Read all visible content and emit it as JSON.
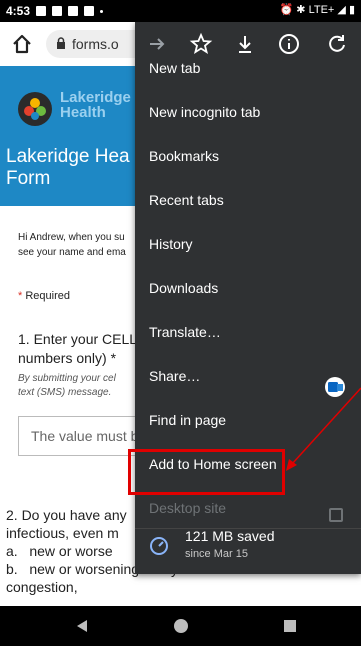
{
  "status_bar": {
    "time": "4:53",
    "network": "LTE+"
  },
  "toolbar": {
    "url": "forms.o"
  },
  "page": {
    "org_name_line1": "Lakeridge",
    "org_name_line2": "Health",
    "form_title_line1": "Lakeridge Hea",
    "form_title_line2": "Form",
    "greeting_line1": "Hi Andrew, when you su",
    "greeting_line2": "see your name and ema",
    "required_label": "Required",
    "q1_line1": "1. Enter your CELL",
    "q1_line2": "numbers only) *",
    "q1_note_line1": "By submitting your cel",
    "q1_note_line2": "text (SMS) message.",
    "answer_placeholder": "The value must b",
    "q2_line1": "2. Do you have any",
    "q2_line2": "infectious, even m",
    "q2_line3a": "a.",
    "q2_line3b": "new or worse",
    "q2_line4a": "b.",
    "q2_line4b": "new or worsening runny nose or nasal",
    "q2_line5": "congestion,"
  },
  "menu": {
    "items": [
      "New tab",
      "New incognito tab",
      "Bookmarks",
      "Recent tabs",
      "History",
      "Downloads",
      "Translate…",
      "Share…",
      "Find in page",
      "Add to Home screen",
      "Desktop site"
    ],
    "data_saved": "121 MB saved",
    "data_saved_since": "since Mar 15"
  },
  "colors": {
    "banner": "#1e88c5",
    "menu_bg": "#2f3133",
    "highlight": "#e00000"
  }
}
